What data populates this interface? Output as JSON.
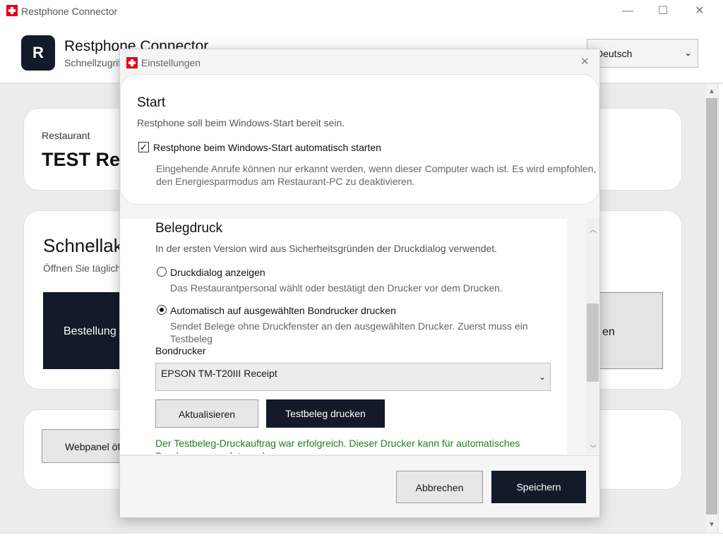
{
  "window": {
    "title": "Restphone Connector",
    "min_glyph": "—",
    "max_glyph": "☐",
    "close_glyph": "✕"
  },
  "header": {
    "logo_letter": "R",
    "app_name": "Restphone Connector",
    "subtitle": "Schnellzugriff",
    "language": {
      "selected": "Deutsch"
    }
  },
  "background": {
    "restaurant_label": "Restaurant",
    "restaurant_name": "TEST Res",
    "quick_title": "Schnellakt",
    "quick_sub": "Öffnen Sie täglich",
    "orders_button": "Bestellung",
    "right_button_fragment": "en",
    "webpanel_button": "Webpanel öf"
  },
  "dialog": {
    "title": "Einstellungen",
    "close_glyph": "✕",
    "start": {
      "heading": "Start",
      "subtitle": "Restphone soll beim Windows-Start bereit sein.",
      "autostart_checked": true,
      "autostart_label": "Restphone beim Windows-Start automatisch starten",
      "hint_line1": "Eingehende Anrufe können nur erkannt werden, wenn dieser Computer wach ist. Es wird empfohlen,",
      "hint_line2": "den Energiesparmodus am Restaurant-PC zu deaktivieren."
    },
    "print": {
      "heading": "Belegdruck",
      "subtitle": "In der ersten Version wird aus Sicherheitsgründen der Druckdialog verwendet.",
      "options": [
        {
          "label": "Druckdialog anzeigen",
          "hint": "Das Restaurantpersonal wählt oder bestätigt den Drucker vor dem Drucken.",
          "selected": false
        },
        {
          "label": "Automatisch auf ausgewählten Bondrucker drucken",
          "hint": "Sendet Belege ohne Druckfenster an den ausgewählten Drucker. Zuerst muss ein Testbeleg",
          "selected": true
        }
      ],
      "printer_label": "Bondrucker",
      "printer_selected": "EPSON TM-T20III Receipt",
      "refresh_button": "Aktualisieren",
      "test_button": "Testbeleg drucken",
      "success_message": "Der Testbeleg-Druckauftrag war erfolgreich. Dieser Drucker kann für automatisches Drucken verwendet werden."
    },
    "footer": {
      "cancel": "Abbrechen",
      "save": "Speichern"
    }
  }
}
